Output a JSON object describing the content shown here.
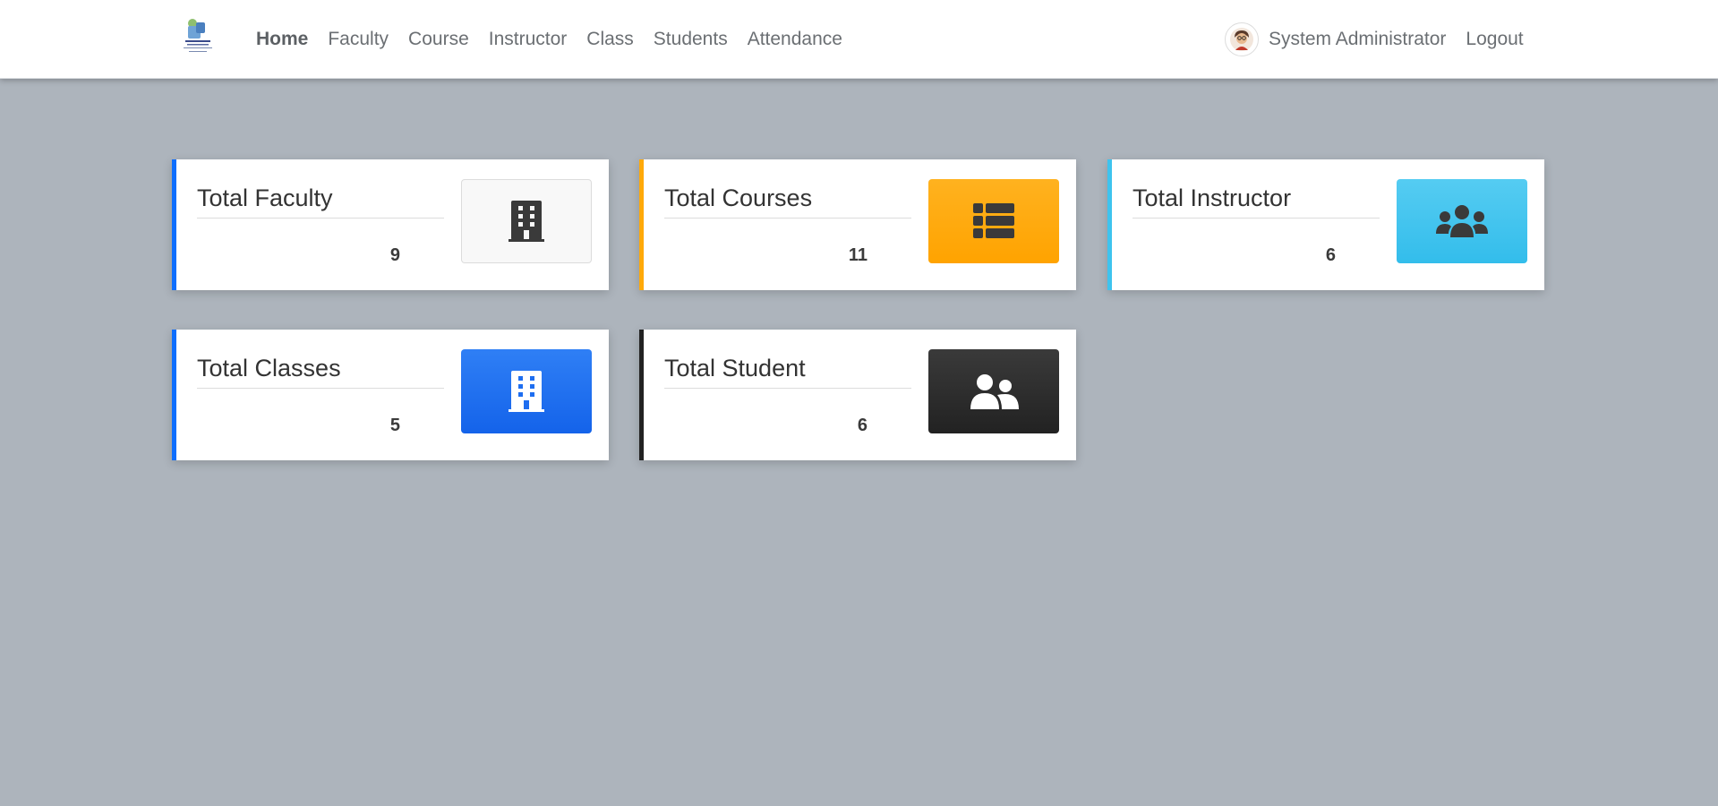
{
  "navbar": {
    "logo": "app-logo",
    "links": [
      {
        "label": "Home",
        "active": true
      },
      {
        "label": "Faculty",
        "active": false
      },
      {
        "label": "Course",
        "active": false
      },
      {
        "label": "Instructor",
        "active": false
      },
      {
        "label": "Class",
        "active": false
      },
      {
        "label": "Students",
        "active": false
      },
      {
        "label": "Attendance",
        "active": false
      }
    ],
    "user_name": "System Administrator",
    "logout_label": "Logout"
  },
  "cards": [
    {
      "title": "Total Faculty",
      "count": "9",
      "icon": "building-icon",
      "accent": "#0d6efd",
      "icon_bg": "#f8f8f8",
      "icon_color": "#3a3a3a"
    },
    {
      "title": "Total Courses",
      "count": "11",
      "icon": "list-icon",
      "accent": "#ffa90a",
      "icon_bg": "#ffa90a",
      "icon_color": "#3a3a3a"
    },
    {
      "title": "Total Instructor",
      "count": "6",
      "icon": "users-icon",
      "accent": "#3ec3ee",
      "icon_bg": "#3ec3ee",
      "icon_color": "#3a3a3a"
    },
    {
      "title": "Total Classes",
      "count": "5",
      "icon": "building-icon",
      "accent": "#0d6efd",
      "icon_bg": "#1e6ef0",
      "icon_color": "#ffffff"
    },
    {
      "title": "Total Student",
      "count": "6",
      "icon": "user-friends-icon",
      "accent": "#222222",
      "icon_bg": "#2b2b2b",
      "icon_color": "#ffffff"
    }
  ]
}
